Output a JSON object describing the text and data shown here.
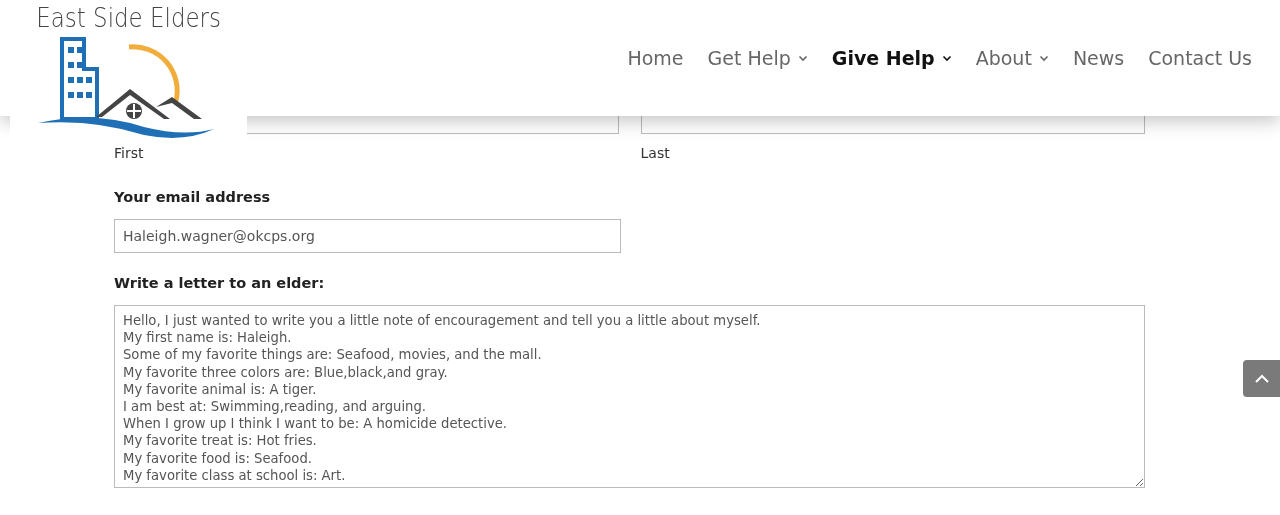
{
  "logo": {
    "title": "East Side Elders"
  },
  "nav": [
    {
      "label": "Home",
      "selected": false,
      "dropdown": false
    },
    {
      "label": "Get Help",
      "selected": false,
      "dropdown": true
    },
    {
      "label": "Give Help",
      "selected": true,
      "dropdown": true
    },
    {
      "label": "About",
      "selected": false,
      "dropdown": true
    },
    {
      "label": "News",
      "selected": false,
      "dropdown": false
    },
    {
      "label": "Contact Us",
      "selected": false,
      "dropdown": false
    }
  ],
  "name": {
    "first": {
      "sublabel": "First"
    },
    "last": {
      "sublabel": "Last"
    }
  },
  "email": {
    "label": "Your email address",
    "value": "Haleigh.wagner@okcps.org"
  },
  "letter": {
    "label": "Write a letter to an elder:",
    "value": "Hello, I just wanted to write you a little note of encouragement and tell you a little about myself.\nMy first name is: Haleigh.\nSome of my favorite things are: Seafood, movies, and the mall.\nMy favorite three colors are: Blue,black,and gray.\nMy favorite animal is: A tiger.\nI am best at: Swimming,reading, and arguing.\nWhen I grow up I think I want to be: A homicide detective.\nMy favorite treat is: Hot fries.\nMy favorite food is: Seafood.\nMy favorite class at school is: Art."
  }
}
